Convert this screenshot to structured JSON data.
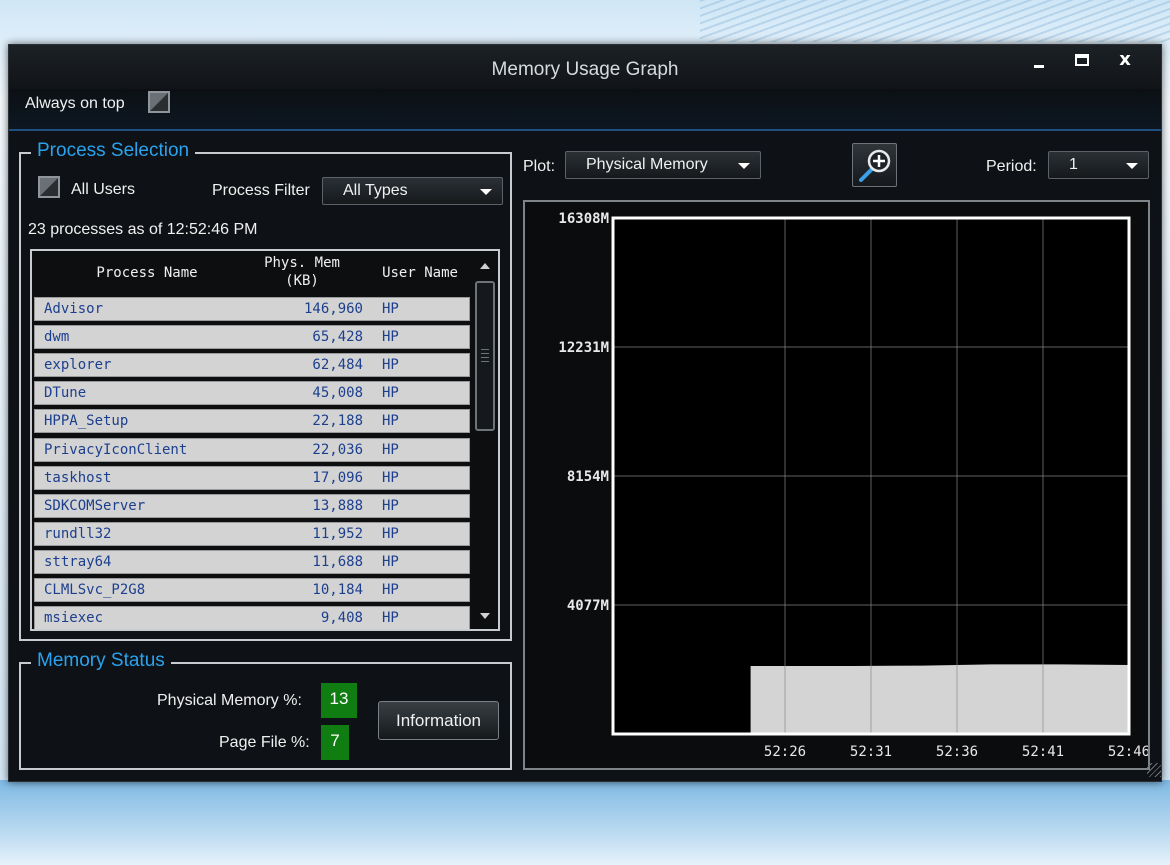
{
  "window": {
    "title": "Memory Usage Graph",
    "controls": {
      "minimize": "minimize",
      "maximize": "maximize",
      "close": "x"
    }
  },
  "topbar": {
    "always_on_top_label": "Always on top",
    "always_on_top_checked": false
  },
  "process_selection": {
    "legend": "Process Selection",
    "all_users_label": "All Users",
    "all_users_checked": false,
    "process_filter_label": "Process Filter",
    "process_filter_value": "All Types",
    "status": "23 processes as of 12:52:46 PM",
    "columns": [
      "Process Name",
      "Phys. Mem",
      "(KB)",
      "User Name"
    ],
    "rows": [
      {
        "name": "Advisor",
        "mem": "146,960",
        "user": "HP"
      },
      {
        "name": "dwm",
        "mem": "65,428",
        "user": "HP"
      },
      {
        "name": "explorer",
        "mem": "62,484",
        "user": "HP"
      },
      {
        "name": "DTune",
        "mem": "45,008",
        "user": "HP"
      },
      {
        "name": "HPPA_Setup",
        "mem": "22,188",
        "user": "HP"
      },
      {
        "name": "PrivacyIconClient",
        "mem": "22,036",
        "user": "HP"
      },
      {
        "name": "taskhost",
        "mem": "17,096",
        "user": "HP"
      },
      {
        "name": "SDKCOMServer",
        "mem": "13,888",
        "user": "HP"
      },
      {
        "name": "rundll32",
        "mem": "11,952",
        "user": "HP"
      },
      {
        "name": "sttray64",
        "mem": "11,688",
        "user": "HP"
      },
      {
        "name": "CLMLSvc_P2G8",
        "mem": "10,184",
        "user": "HP"
      },
      {
        "name": "msiexec",
        "mem": "9,408",
        "user": "HP"
      }
    ]
  },
  "memory_status": {
    "legend": "Memory Status",
    "physical_label": "Physical Memory %:",
    "physical_value": "13",
    "pagefile_label": "Page File %:",
    "pagefile_value": "7",
    "info_button": "Information",
    "badge_color": "#0f7d12"
  },
  "plot_controls": {
    "plot_label": "Plot:",
    "plot_value": "Physical Memory",
    "zoom_icon": "zoom-in-icon",
    "period_label": "Period:",
    "period_value": "1"
  },
  "chart_data": {
    "type": "area",
    "y_tick_labels": [
      "16308M",
      "12231M",
      "8154M",
      "4077M"
    ],
    "y_ticks": [
      16308,
      12231,
      8154,
      4077
    ],
    "ylim": [
      0,
      16308
    ],
    "x_tick_labels": [
      "52:26",
      "52:31",
      "52:36",
      "52:41",
      "52:46"
    ],
    "xlim": [
      0,
      30
    ],
    "x": [
      8,
      10,
      14,
      18,
      22,
      26,
      30
    ],
    "values": [
      2150,
      2150,
      2150,
      2160,
      2200,
      2200,
      2180
    ],
    "fill_color": "#d4d4d4",
    "grid": true
  }
}
